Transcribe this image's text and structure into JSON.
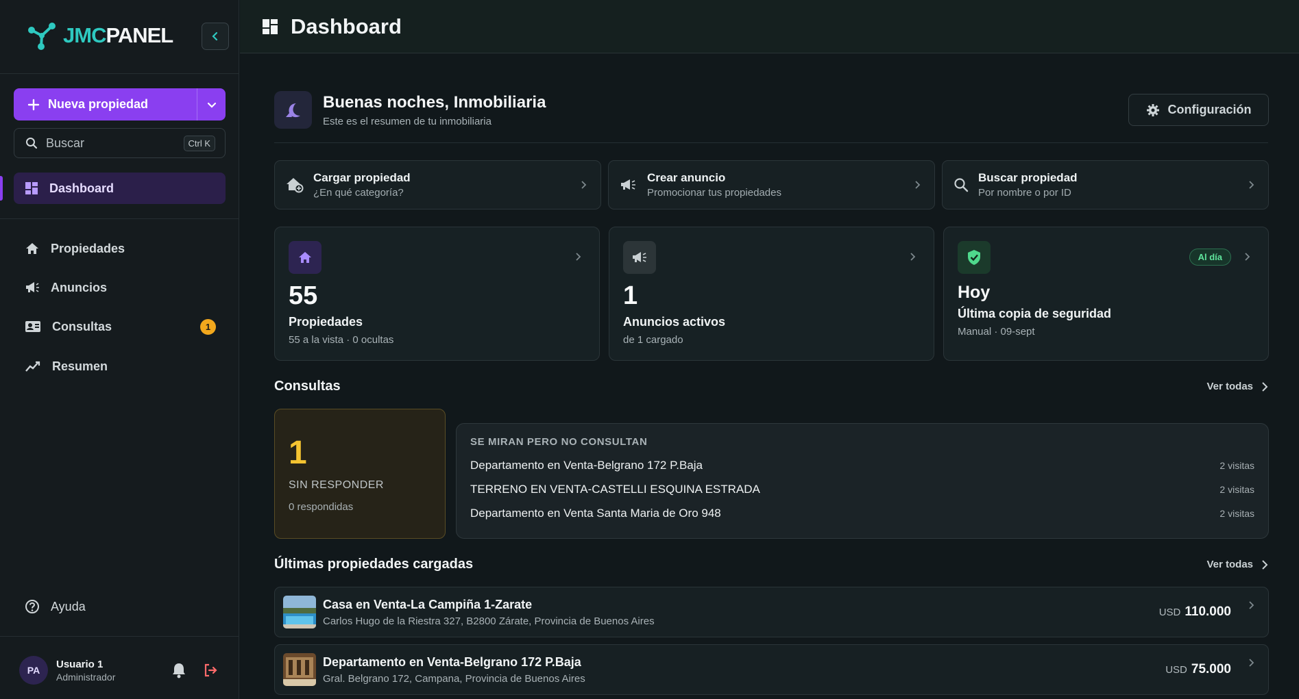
{
  "brand": {
    "part1": "JMC",
    "part2": "PANEL"
  },
  "sidebar": {
    "new_property_label": "Nueva propiedad",
    "search_placeholder": "Buscar",
    "search_shortcut": "Ctrl K",
    "dashboard_label": "Dashboard",
    "items": [
      {
        "label": "Propiedades",
        "icon": "home-icon"
      },
      {
        "label": "Anuncios",
        "icon": "megaphone-icon"
      },
      {
        "label": "Consultas",
        "icon": "contact-card-icon",
        "badge": "1"
      },
      {
        "label": "Resumen",
        "icon": "trend-chart-icon"
      }
    ],
    "help_label": "Ayuda",
    "user": {
      "initials": "PA",
      "name": "Usuario 1",
      "role": "Administrador"
    }
  },
  "header": {
    "title": "Dashboard"
  },
  "greeting": {
    "title": "Buenas noches, Inmobiliaria",
    "subtitle": "Este es el resumen de tu inmobiliaria",
    "config_label": "Configuración"
  },
  "quick_actions": [
    {
      "title": "Cargar propiedad",
      "subtitle": "¿En qué categoría?"
    },
    {
      "title": "Crear anuncio",
      "subtitle": "Promocionar tus propiedades"
    },
    {
      "title": "Buscar propiedad",
      "subtitle": "Por nombre o por ID"
    }
  ],
  "stats": [
    {
      "value": "55",
      "label": "Propiedades",
      "sub": "55 a la vista · 0 ocultas"
    },
    {
      "value": "1",
      "label": "Anuncios activos",
      "sub": "de 1 cargado"
    },
    {
      "value": "Hoy",
      "label": "Última copia de seguridad",
      "sub": "Manual · 09-sept",
      "pill": "Al día"
    }
  ],
  "consultas": {
    "title": "Consultas",
    "see_all": "Ver todas",
    "pending_count": "1",
    "pending_label": "SIN RESPONDER",
    "answered": "0 respondidas",
    "watch_header": "SE MIRAN PERO NO CONSULTAN",
    "watch_items": [
      {
        "title": "Departamento en Venta-Belgrano 172 P.Baja",
        "visits": "2 visitas"
      },
      {
        "title": "TERRENO EN VENTA-CASTELLI ESQUINA ESTRADA",
        "visits": "2 visitas"
      },
      {
        "title": "Departamento en Venta Santa Maria de Oro 948",
        "visits": "2 visitas"
      }
    ]
  },
  "latest": {
    "title": "Últimas propiedades cargadas",
    "see_all": "Ver todas",
    "items": [
      {
        "title": "Casa en Venta-La Campiña 1-Zarate",
        "address": "Carlos Hugo de la Riestra 327, B2800 Zárate, Provincia de Buenos Aires",
        "currency": "USD",
        "price": "110.000"
      },
      {
        "title": "Departamento en Venta-Belgrano 172 P.Baja",
        "address": "Gral. Belgrano 172, Campana, Provincia de Buenos Aires",
        "currency": "USD",
        "price": "75.000"
      }
    ]
  },
  "colors": {
    "accent": "#8a3ff0",
    "teal": "#2ec9c0",
    "warning": "#f4c331",
    "success": "#5fe39c"
  }
}
